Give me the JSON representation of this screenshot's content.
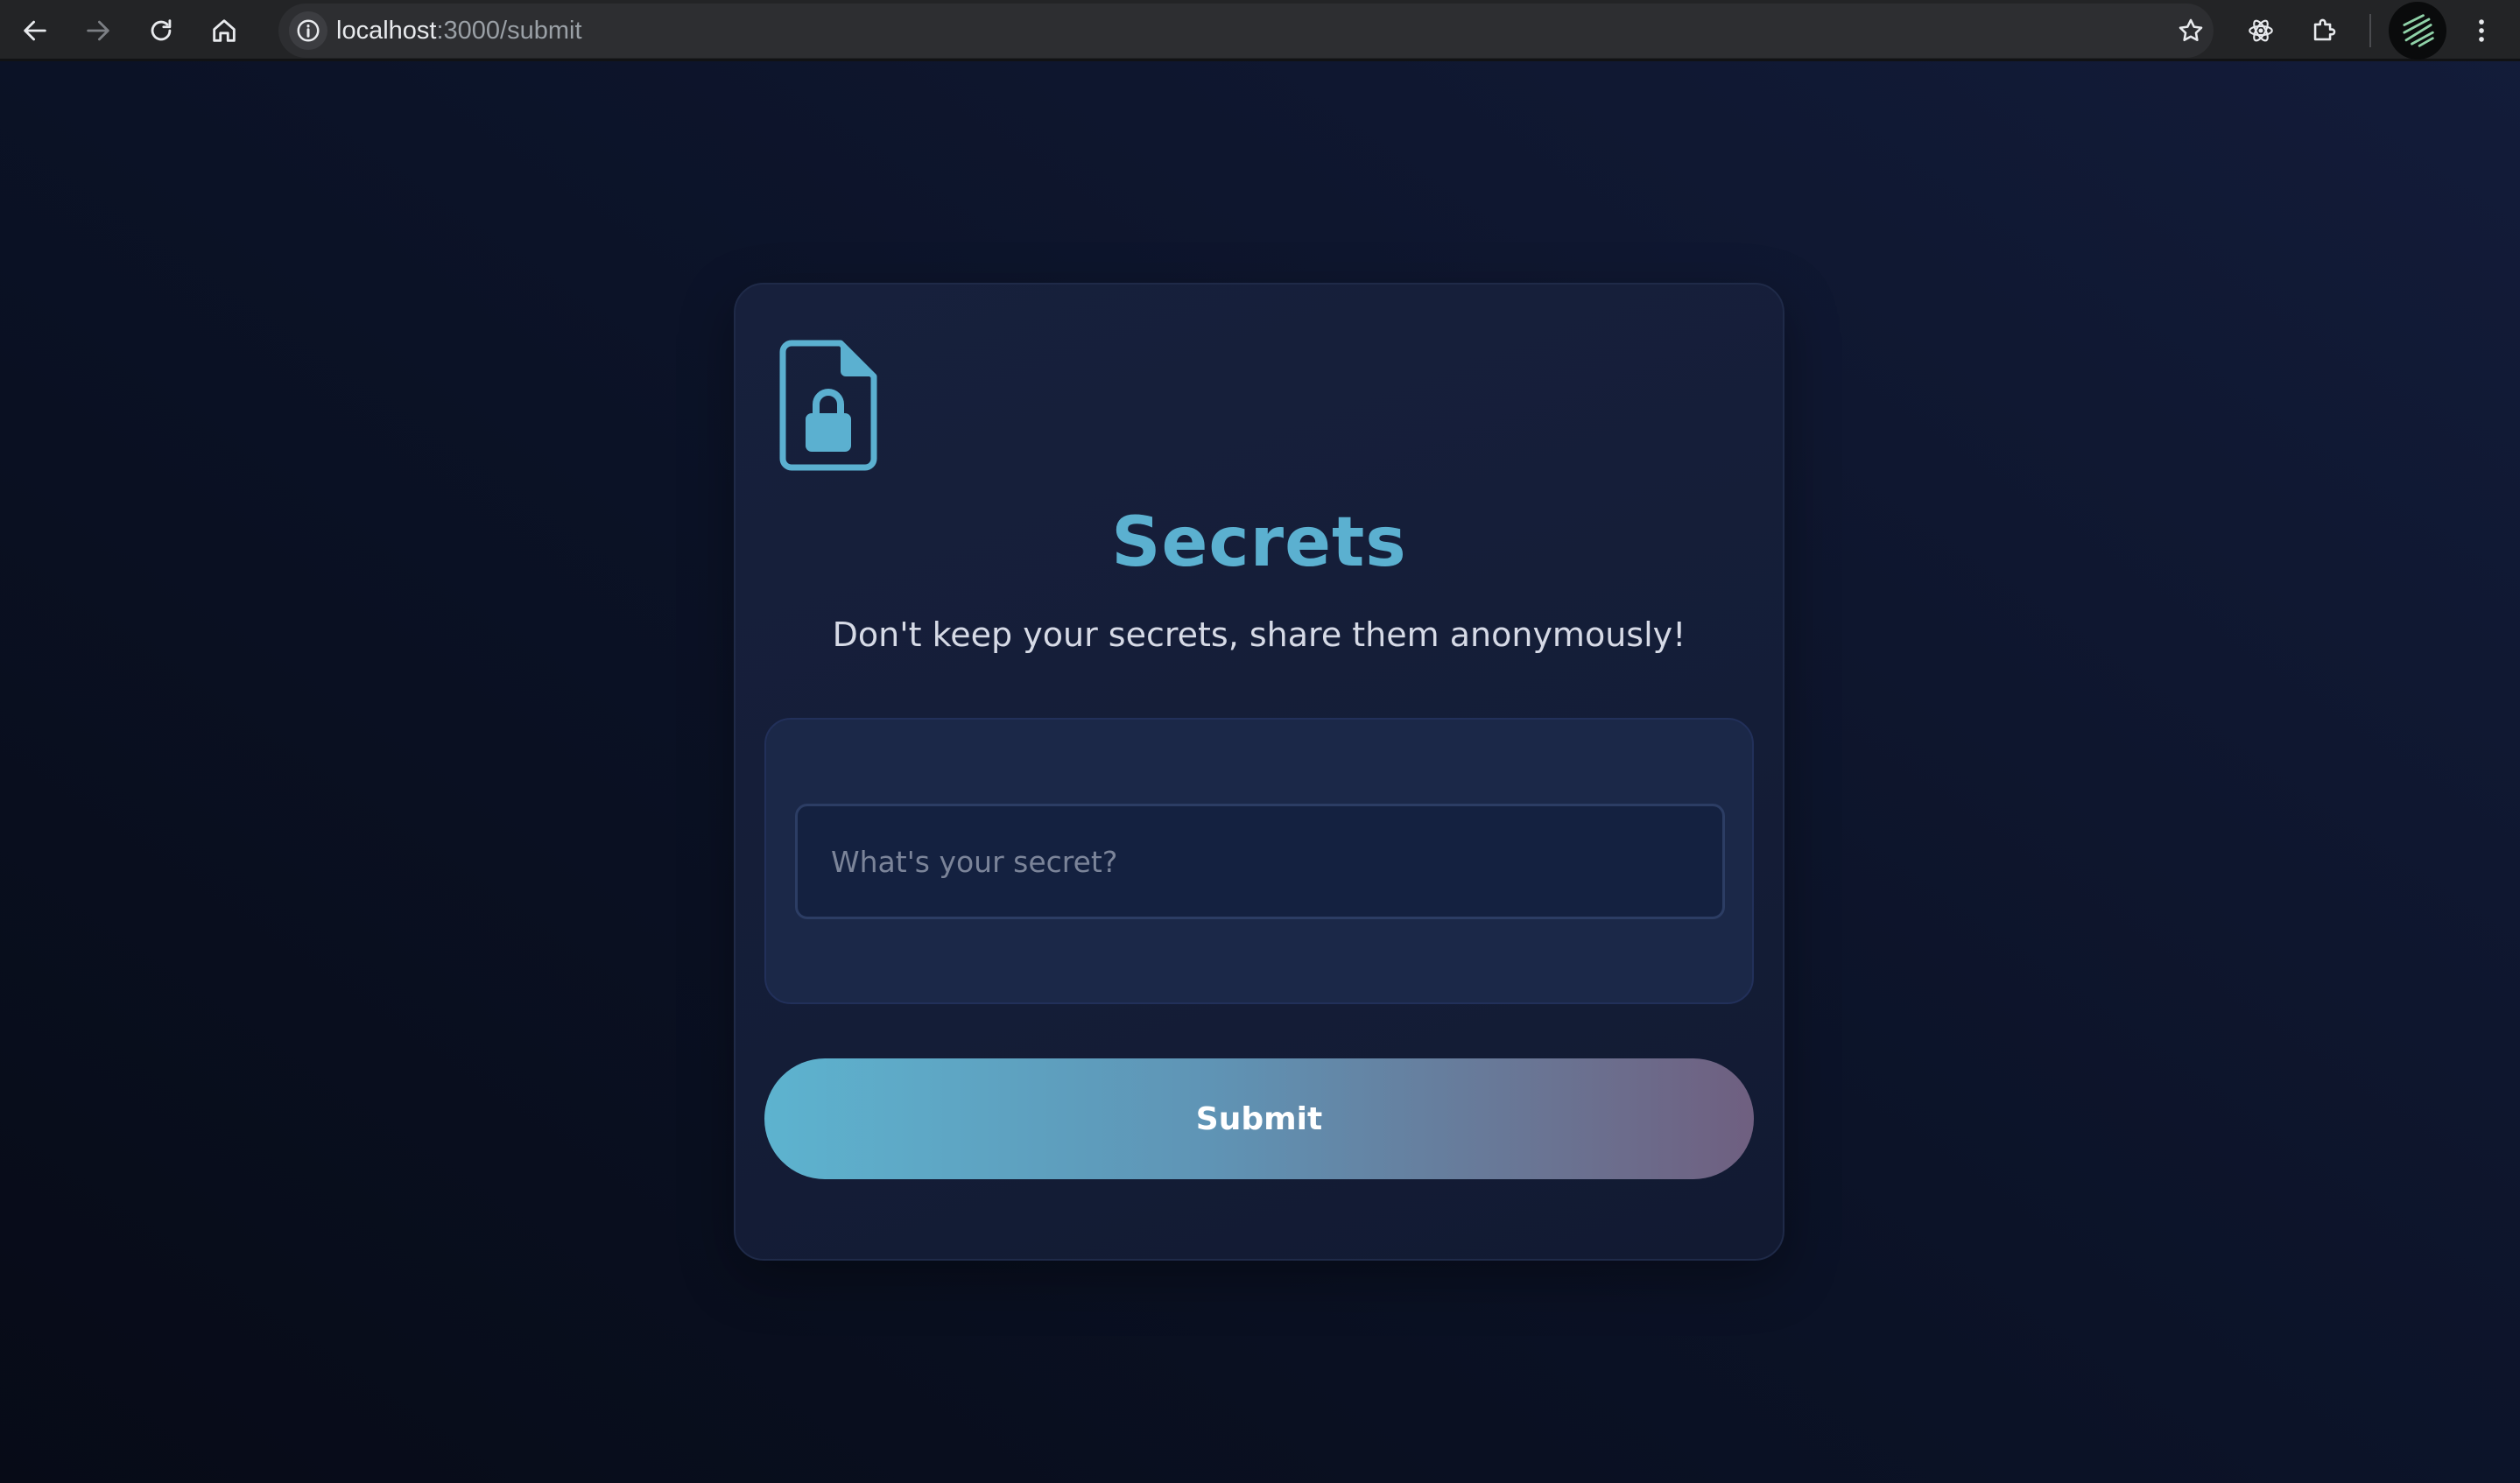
{
  "browser": {
    "url_host": "localhost",
    "url_path": ":3000/submit",
    "icons": {
      "back": "arrow-left-icon",
      "forward": "arrow-right-icon",
      "reload": "reload-icon",
      "home": "home-icon",
      "site_info": "info-icon",
      "bookmark": "star-icon",
      "react_devtools": "atom-icon",
      "extensions": "puzzle-icon",
      "profile": "avatar",
      "menu": "kebab-menu-icon"
    }
  },
  "card": {
    "icon": "file-lock-icon",
    "title": "Secrets",
    "subtitle": "Don't keep your secrets, share them anonymously!",
    "input": {
      "placeholder": "What's your secret?",
      "value": ""
    },
    "submit_label": "Submit"
  },
  "colors": {
    "accent": "#5bb0d0",
    "background": "#0b1226",
    "card": "#17203c",
    "button_gradient_start": "#5db3cf",
    "button_gradient_end": "#6f5f80"
  }
}
